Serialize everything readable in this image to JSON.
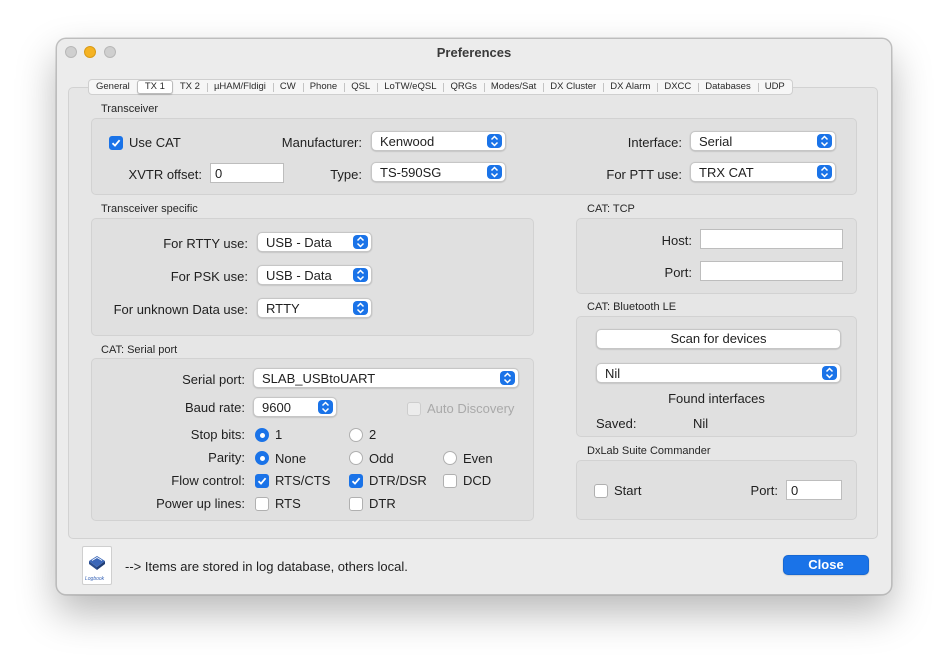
{
  "window": {
    "title": "Preferences"
  },
  "tabs": [
    "General",
    "TX 1",
    "TX 2",
    "µHAM/Fldigi",
    "CW",
    "Phone",
    "QSL",
    "LoTW/eQSL",
    "QRGs",
    "Modes/Sat",
    "DX Cluster",
    "DX Alarm",
    "DXCC",
    "Databases",
    "UDP"
  ],
  "active_tab": "TX 1",
  "transceiver": {
    "title": "Transceiver",
    "use_cat_label": "Use CAT",
    "use_cat_checked": true,
    "manufacturer_label": "Manufacturer:",
    "manufacturer_value": "Kenwood",
    "interface_label": "Interface:",
    "interface_value": "Serial",
    "xvtr_label": "XVTR offset:",
    "xvtr_value": "0",
    "type_label": "Type:",
    "type_value": "TS-590SG",
    "ptt_label": "For PTT use:",
    "ptt_value": "TRX CAT"
  },
  "specific": {
    "title": "Transceiver specific",
    "rtty_label": "For RTTY use:",
    "rtty_value": "USB - Data",
    "psk_label": "For PSK use:",
    "psk_value": "USB - Data",
    "unknown_label": "For unknown Data use:",
    "unknown_value": "RTTY"
  },
  "serial": {
    "title": "CAT: Serial port",
    "port_label": "Serial port:",
    "port_value": "SLAB_USBtoUART",
    "baud_label": "Baud rate:",
    "baud_value": "9600",
    "auto_discovery_label": "Auto Discovery",
    "stop_bits_label": "Stop bits:",
    "stop_1": "1",
    "stop_2": "2",
    "parity_label": "Parity:",
    "parity_none": "None",
    "parity_odd": "Odd",
    "parity_even": "Even",
    "flow_label": "Flow control:",
    "flow_rts": "RTS/CTS",
    "flow_dtr": "DTR/DSR",
    "flow_dcd": "DCD",
    "power_label": "Power up lines:",
    "power_rts": "RTS",
    "power_dtr": "DTR"
  },
  "tcp": {
    "title": "CAT: TCP",
    "host_label": "Host:",
    "host_value": "",
    "port_label": "Port:",
    "port_value": ""
  },
  "ble": {
    "title": "CAT: Bluetooth LE",
    "scan_button": "Scan for devices",
    "device_value": "Nil",
    "found_label": "Found interfaces",
    "saved_label": "Saved:",
    "saved_value": "Nil"
  },
  "dxlab": {
    "title": "DxLab Suite Commander",
    "start_label": "Start",
    "port_label": "Port:",
    "port_value": "0"
  },
  "footer": {
    "note": "--> Items are stored in log database, others local.",
    "close_button": "Close",
    "logo_text": "Logbook"
  },
  "colors": {
    "accent": "#1a73e8",
    "window_bg": "#ececec",
    "traffic_yellow": "#f5b323"
  }
}
